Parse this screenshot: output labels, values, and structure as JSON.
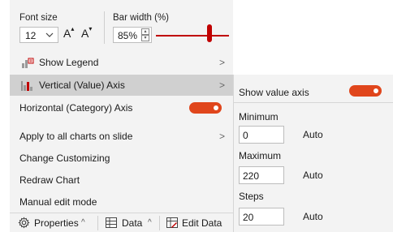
{
  "font_size": {
    "label": "Font size",
    "value": "12",
    "increase_glyph": "A",
    "decrease_glyph": "A"
  },
  "bar_width": {
    "label": "Bar width (%)",
    "value": "85%"
  },
  "menu": {
    "show_legend": "Show Legend",
    "vertical_axis": "Vertical (Value) Axis",
    "horizontal_axis": "Horizontal (Category) Axis",
    "apply_all": "Apply to all charts on slide",
    "change_customizing": "Change Customizing",
    "redraw_chart": "Redraw Chart",
    "manual_edit": "Manual edit mode",
    "submenu_arrow": ">"
  },
  "bottom_bar": {
    "properties": "Properties",
    "data": "Data",
    "edit_data": "Edit Data"
  },
  "value_axis_panel": {
    "show_label": "Show value axis",
    "minimum_label": "Minimum",
    "minimum_value": "0",
    "maximum_label": "Maximum",
    "maximum_value": "220",
    "steps_label": "Steps",
    "steps_value": "20",
    "auto_label": "Auto"
  },
  "colors": {
    "accent": "#c00000",
    "toggle_on": "#e0461c",
    "active_row": "#d0d0d0",
    "panel_bg": "#f3f3f3"
  },
  "icons": [
    "chevron-down-icon",
    "increase-font-icon",
    "decrease-font-icon",
    "spinner-up-icon",
    "spinner-down-icon",
    "legend-icon",
    "bar-chart-icon",
    "gear-icon",
    "table-icon",
    "edit-data-icon",
    "chevron-right-icon",
    "chevron-up-icon"
  ]
}
